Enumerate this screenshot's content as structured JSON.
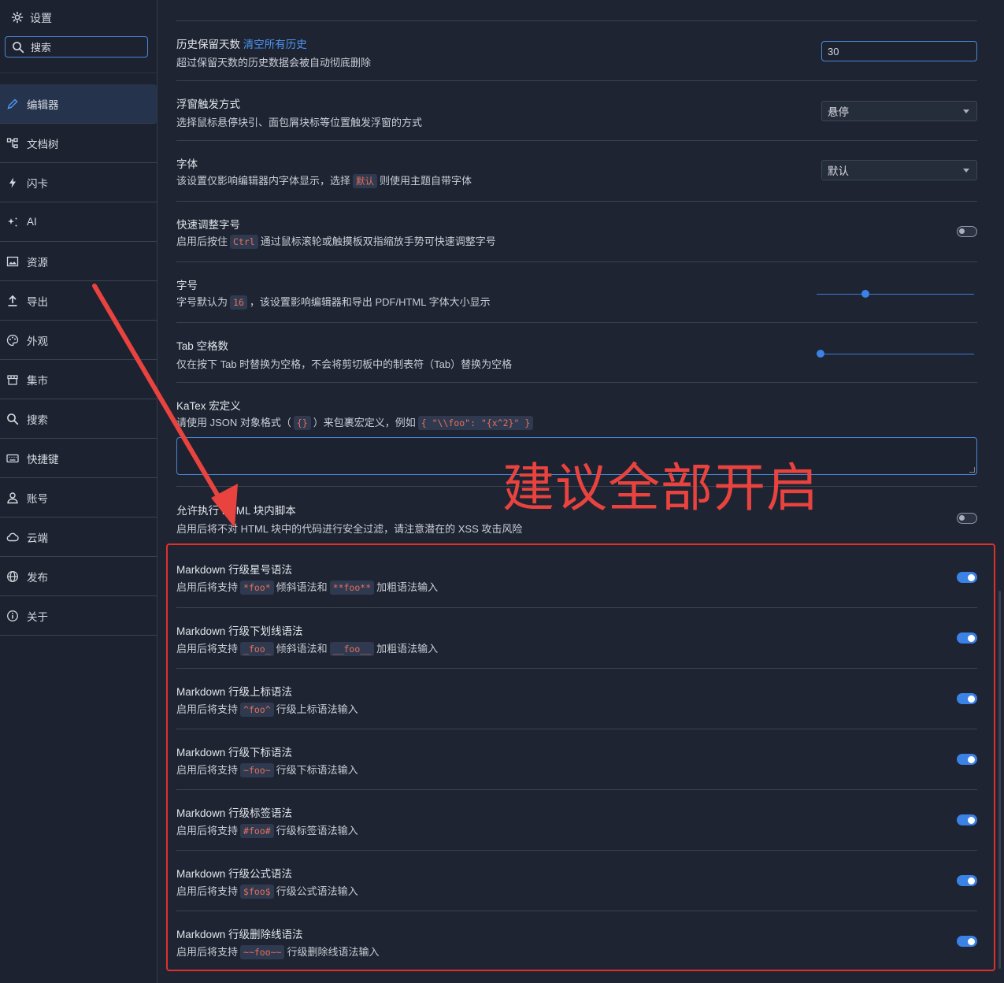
{
  "sidebar": {
    "title": "设置",
    "search_value": "搜索",
    "items": [
      {
        "label": "编辑器",
        "icon": "pencil-icon",
        "active": true
      },
      {
        "label": "文档树",
        "icon": "tree-icon"
      },
      {
        "label": "闪卡",
        "icon": "lightning-icon"
      },
      {
        "label": "AI",
        "icon": "sparkle-icon"
      },
      {
        "label": "资源",
        "icon": "image-icon"
      },
      {
        "label": "导出",
        "icon": "upload-icon"
      },
      {
        "label": "外观",
        "icon": "palette-icon"
      },
      {
        "label": "集市",
        "icon": "store-icon"
      },
      {
        "label": "搜索",
        "icon": "search-icon"
      },
      {
        "label": "快捷键",
        "icon": "keyboard-icon"
      },
      {
        "label": "账号",
        "icon": "user-icon"
      },
      {
        "label": "云端",
        "icon": "cloud-icon"
      },
      {
        "label": "发布",
        "icon": "globe-icon"
      },
      {
        "label": "关于",
        "icon": "info-icon"
      }
    ]
  },
  "settings": {
    "history": {
      "title": "历史保留天数",
      "link": "清空所有历史",
      "desc": "超过保留天数的历史数据会被自动彻底删除",
      "value": "30"
    },
    "popover": {
      "title": "浮窗触发方式",
      "desc": "选择鼠标悬停块引、面包屑块标等位置触发浮窗的方式",
      "value": "悬停"
    },
    "font": {
      "title": "字体",
      "desc_a": "该设置仅影响编辑器内字体显示，选择",
      "code": "默认",
      "desc_b": "则使用主题自带字体",
      "value": "默认"
    },
    "quick_font": {
      "title": "快速调整字号",
      "desc_a": "启用后按住",
      "code": "Ctrl",
      "desc_b": "通过鼠标滚轮或触摸板双指缩放手势可快速调整字号",
      "enabled": false
    },
    "font_size": {
      "title": "字号",
      "desc_a": "字号默认为",
      "code": "16",
      "desc_b": "，该设置影响编辑器和导出 PDF/HTML 字体大小显示",
      "level": 0.3
    },
    "tab_width": {
      "title": "Tab 空格数",
      "desc": "仅在按下 Tab 时替换为空格，不会将剪切板中的制表符（Tab）替换为空格",
      "level": 0.0
    },
    "katex": {
      "title": "KaTex 宏定义",
      "desc_a": "请使用 JSON 对象格式（",
      "code_a": "{}",
      "desc_b": "）来包裹宏定义，例如",
      "code_b": "{ \"\\\\foo\": \"{x^2}\" }"
    },
    "html_script": {
      "title": "允许执行 HTML 块内脚本",
      "desc": "启用后将不对 HTML 块中的代码进行安全过滤，请注意潜在的 XSS 攻击风险",
      "enabled": false
    },
    "markdown": [
      {
        "title": "Markdown 行级星号语法",
        "desc_a": "启用后将支持",
        "code_a": "*foo*",
        "mid": "倾斜语法和",
        "code_b": "**foo**",
        "desc_b": "加粗语法输入",
        "enabled": true
      },
      {
        "title": "Markdown 行级下划线语法",
        "desc_a": "启用后将支持",
        "code_a": "_foo_",
        "mid": "倾斜语法和",
        "code_b": "__foo__",
        "desc_b": "加粗语法输入",
        "enabled": true
      },
      {
        "title": "Markdown 行级上标语法",
        "desc_a": "启用后将支持",
        "code_a": "^foo^",
        "desc_b": "行级上标语法输入",
        "enabled": true
      },
      {
        "title": "Markdown 行级下标语法",
        "desc_a": "启用后将支持",
        "code_a": "~foo~",
        "desc_b": "行级下标语法输入",
        "enabled": true
      },
      {
        "title": "Markdown 行级标签语法",
        "desc_a": "启用后将支持",
        "code_a": "#foo#",
        "desc_b": "行级标签语法输入",
        "enabled": true
      },
      {
        "title": "Markdown 行级公式语法",
        "desc_a": "启用后将支持",
        "code_a": "$foo$",
        "desc_b": "行级公式语法输入",
        "enabled": true
      },
      {
        "title": "Markdown 行级删除线语法",
        "desc_a": "启用后将支持",
        "code_a": "~~foo~~",
        "desc_b": "行级删除线语法输入",
        "enabled": true
      }
    ]
  },
  "annotation": {
    "text": "建议全部开启",
    "color": "#e8433f"
  },
  "colors": {
    "accent": "#3b82e6",
    "background": "#1e2432",
    "sidebar": "#1c2230",
    "code": "#e86f58"
  }
}
